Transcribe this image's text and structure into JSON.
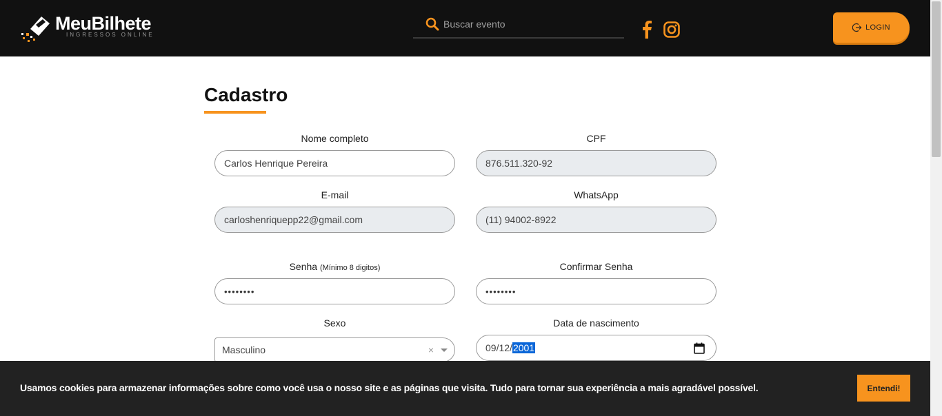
{
  "header": {
    "logo_text": "MeuBilhete",
    "logo_subtitle": "INGRESSOS ONLINE",
    "search_placeholder": "Buscar evento",
    "login_label": "LOGIN"
  },
  "page": {
    "title": "Cadastro"
  },
  "form": {
    "nome": {
      "label": "Nome completo",
      "value": "Carlos Henrique Pereira"
    },
    "cpf": {
      "label": "CPF",
      "value": "876.511.320-92"
    },
    "email": {
      "label": "E-mail",
      "value": "carloshenriquepp22@gmail.com"
    },
    "whatsapp": {
      "label": "WhatsApp",
      "value": "(11) 94002-8922"
    },
    "senha": {
      "label": "Senha",
      "hint": "(Mínimo 8 digitos)",
      "value": "••••••••"
    },
    "confirmar": {
      "label": "Confirmar Senha",
      "value": "••••••••"
    },
    "sexo": {
      "label": "Sexo",
      "value": "Masculino",
      "clear": "×"
    },
    "nascimento": {
      "label": "Data de nascimento",
      "month": "09",
      "day": "12",
      "year": "2001"
    }
  },
  "cookie": {
    "text": "Usamos cookies para armazenar informações sobre como você usa o nosso site e as páginas que visita. Tudo para tornar sua experiência a mais agradável possível.",
    "button": "Entendi!"
  },
  "colors": {
    "accent": "#f7931e",
    "header_bg": "#111111",
    "cookie_bg": "#222222",
    "date_highlight": "#0a66d8"
  },
  "icons": [
    "search-icon",
    "facebook-icon",
    "instagram-icon",
    "login-icon",
    "calendar-icon",
    "chevron-down-icon",
    "logo-ticket-icon"
  ]
}
